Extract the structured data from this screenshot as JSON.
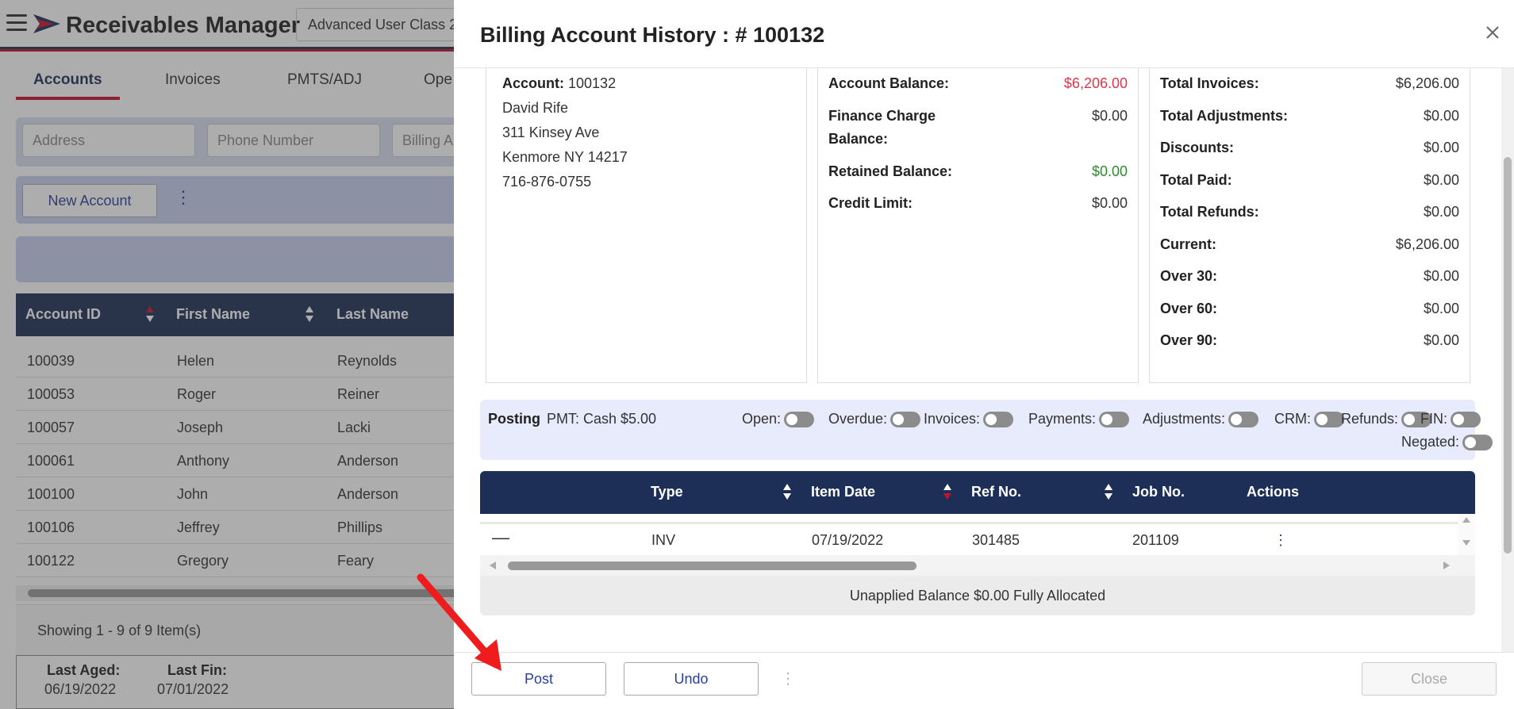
{
  "app": {
    "title": "Receivables Manager",
    "class_select": "Advanced User Class 2"
  },
  "tabs": [
    "Accounts",
    "Invoices",
    "PMTS/ADJ",
    "Ope"
  ],
  "filters": {
    "address_placeholder": "Address",
    "phone_placeholder": "Phone Number",
    "billing_placeholder": "Billing A"
  },
  "actions": {
    "new_account": "New Account"
  },
  "grid": {
    "headers": [
      "Account ID",
      "First Name",
      "Last Name"
    ],
    "rows": [
      [
        "100039",
        "Helen",
        "Reynolds"
      ],
      [
        "100053",
        "Roger",
        "Reiner"
      ],
      [
        "100057",
        "Joseph",
        "Lacki"
      ],
      [
        "100061",
        "Anthony",
        "Anderson"
      ],
      [
        "100100",
        "John",
        "Anderson"
      ],
      [
        "100106",
        "Jeffrey",
        "Phillips"
      ],
      [
        "100122",
        "Gregory",
        "Feary"
      ]
    ],
    "pager": "Showing 1 - 9 of 9 Item(s)"
  },
  "aged": {
    "last_aged_label": "Last Aged:",
    "last_aged_value": "06/19/2022",
    "last_fin_label": "Last Fin:",
    "last_fin_value": "07/01/2022"
  },
  "modal": {
    "title": "Billing Account History : # 100132",
    "account": {
      "label": "Account:",
      "number": "100132",
      "name": "David Rife",
      "street": "311 Kinsey Ave",
      "city": "Kenmore NY 14217",
      "phone": "716-876-0755"
    },
    "balances": [
      {
        "label": "Account Balance:",
        "value": "$6,206.00"
      },
      {
        "label": "Finance Charge",
        "label2": "Balance:",
        "value": "$0.00"
      },
      {
        "label": "Retained Balance:",
        "value": "$0.00"
      },
      {
        "label": "Credit Limit:",
        "value": "$0.00"
      }
    ],
    "totals": [
      {
        "label": "Total Invoices:",
        "value": "$6,206.00"
      },
      {
        "label": "Total Adjustments:",
        "value": "$0.00"
      },
      {
        "label": "Discounts:",
        "value": "$0.00"
      },
      {
        "label": "Total Paid:",
        "value": "$0.00"
      },
      {
        "label": "Total Refunds:",
        "value": "$0.00"
      },
      {
        "label": "Current:",
        "value": "$6,206.00"
      },
      {
        "label": "Over 30:",
        "value": "$0.00"
      },
      {
        "label": "Over 60:",
        "value": "$0.00"
      },
      {
        "label": "Over 90:",
        "value": "$0.00"
      }
    ],
    "posting": {
      "label": "Posting",
      "value": "PMT: Cash $5.00",
      "toggles": [
        "Open:",
        "Overdue:",
        "Invoices:",
        "Payments:",
        "Adjustments:",
        "CRM:",
        "Refunds:",
        "FIN:",
        "Negated:"
      ]
    },
    "items": {
      "headers": [
        "Type",
        "Item Date",
        "Ref No.",
        "Job No.",
        "Actions"
      ],
      "row": {
        "type": "INV",
        "date": "07/19/2022",
        "ref": "301485",
        "job": "201109"
      },
      "unapplied": "Unapplied Balance $0.00 Fully Allocated"
    },
    "footer": {
      "post": "Post",
      "undo": "Undo",
      "close": "Close"
    }
  },
  "colors": {
    "navy": "#1d2f57",
    "accent_red": "#c8102e",
    "link_blue": "#2a3f9a",
    "negative_red": "#d9384a",
    "positive_green": "#2c8c2c"
  }
}
